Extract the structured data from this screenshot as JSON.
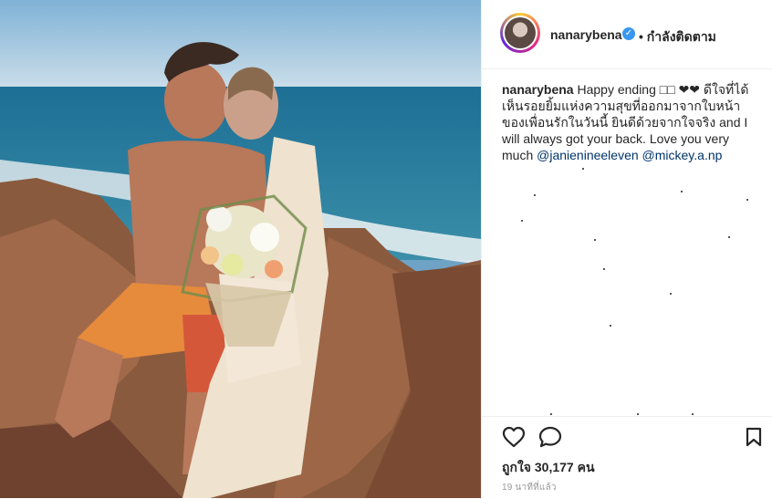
{
  "post": {
    "username": "nanarybena",
    "follow_status": "• กำลังติดตาม",
    "caption": {
      "username": "nanarybena",
      "text": "Happy ending □□ ❤❤ ดีใจที่ได้เห็นรอยยิ้มแห่งความสุขที่ออกมาจากใบหน้าของเพื่อนรักในวันนี้ ยินดีด้วยจากใจจริง and I will always got your back. Love you very much",
      "mention_1": "@janienineeleven",
      "mention_2": "@mickey.a.np"
    },
    "likes": "ถูกใจ 30,177 คน",
    "time_ago": "19 นาทีที่แล้ว"
  },
  "icons": {
    "like": "heart-outline-icon",
    "comment": "comment-bubble-icon",
    "save": "bookmark-icon",
    "verified": "verified-badge-icon"
  },
  "colors": {
    "verified_blue": "#3897f0",
    "mention": "#003569",
    "timestamp": "#999999"
  }
}
